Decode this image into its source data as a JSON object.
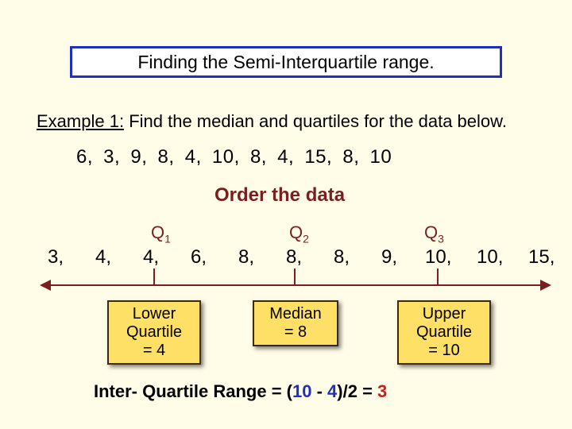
{
  "title": "Finding the Semi-Interquartile range.",
  "example_label": "Example 1:",
  "example_text": "Find the median and quartiles for the data below.",
  "unordered": "6,   3,   9,   8,   4,   10,   8,    4,   15,   8,   10",
  "order_instr": "Order the data",
  "q_labels": {
    "q1": "Q",
    "q1s": "1",
    "q2": "Q",
    "q2s": "2",
    "q3": "Q",
    "q3s": "3"
  },
  "ordered": [
    "3,",
    "4,",
    "4,",
    "6,",
    "8,",
    "8,",
    "8,",
    "9,",
    "10,",
    "10,",
    "15,"
  ],
  "box_lower": {
    "l1": "Lower",
    "l2": "Quartile",
    "l3": "= 4"
  },
  "box_median": {
    "l1": "Median",
    "l2": "= 8"
  },
  "box_upper": {
    "l1": "Upper",
    "l2": "Quartile",
    "l3": "= 10"
  },
  "iqr": {
    "pre": "Inter- Quartile Range = (",
    "upper": "10",
    "mid": "  - ",
    "lower": "4",
    "post": ")/2 = ",
    "result": "3"
  },
  "chart_data": {
    "type": "table",
    "title": "Finding the Semi-Interquartile range",
    "raw_data": [
      6,
      3,
      9,
      8,
      4,
      10,
      8,
      4,
      15,
      8,
      10
    ],
    "ordered_data": [
      3,
      4,
      4,
      6,
      8,
      8,
      8,
      9,
      10,
      10,
      15
    ],
    "Q1": 4,
    "median": 8,
    "Q3": 10,
    "semi_interquartile_range": 3
  }
}
